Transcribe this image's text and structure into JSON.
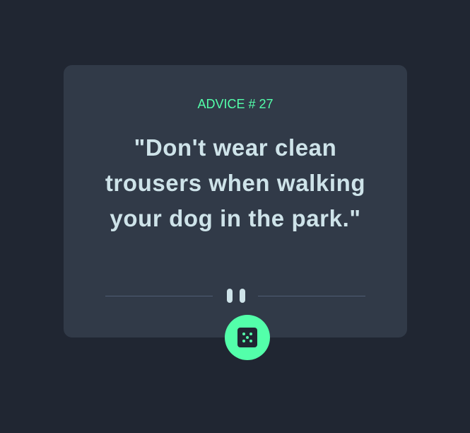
{
  "advice": {
    "id_label": "ADVICE # 27",
    "text": "\"Don't wear clean trousers when walking your dog in the park.\""
  },
  "icons": {
    "divider": "pause-icon",
    "button": "dice-icon"
  },
  "colors": {
    "background": "#202632",
    "card": "#313a48",
    "accent": "#53ffaa",
    "text": "#cee3e9",
    "divider": "#4f5d74"
  }
}
